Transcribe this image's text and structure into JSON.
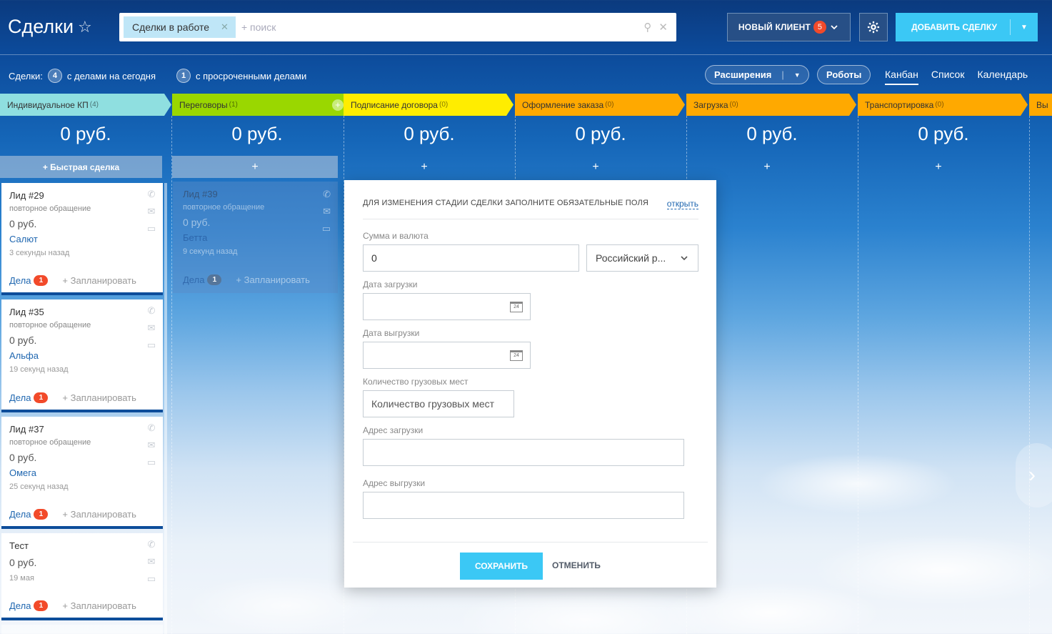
{
  "header": {
    "title": "Сделки",
    "filter_chip": "Сделки в работе",
    "search_placeholder": "+ поиск",
    "new_client_label": "НОВЫЙ КЛИЕНТ",
    "new_client_badge": "5",
    "add_deal_label": "ДОБАВИТЬ СДЕЛКУ"
  },
  "counters": {
    "prefix": "Сделки:",
    "today_count": "4",
    "today_label": "с делами на сегодня",
    "overdue_count": "1",
    "overdue_label": "с просроченными делами"
  },
  "toolbar": {
    "extensions": "Расширения",
    "robots": "Роботы",
    "views": [
      "Канбан",
      "Список",
      "Календарь"
    ]
  },
  "stages": [
    {
      "name": "Индивидуальное КП",
      "count": "(4)",
      "color": "#8fdfe0",
      "sum": "0 руб.",
      "add": "+ Быстрая сделка"
    },
    {
      "name": "Переговоры",
      "count": "(1)",
      "color": "#9ad700",
      "sum": "0 руб.",
      "add": "+"
    },
    {
      "name": "Подписание договора",
      "count": "(0)",
      "color": "#ffed00",
      "sum": "0 руб.",
      "add": "+"
    },
    {
      "name": "Оформление заказа",
      "count": "(0)",
      "color": "#ffa900",
      "sum": "0 руб.",
      "add": "+"
    },
    {
      "name": "Загрузка",
      "count": "(0)",
      "color": "#ffa900",
      "sum": "0 руб.",
      "add": "+"
    },
    {
      "name": "Транспортировка",
      "count": "(0)",
      "color": "#ffa900",
      "sum": "0 руб.",
      "add": "+"
    },
    {
      "name": "Вы",
      "count": "",
      "color": "#ffa900"
    }
  ],
  "cards": [
    {
      "name": "Лид #29",
      "sub": "повторное обращение",
      "amount": "0 руб.",
      "client": "Салют",
      "time": "3 секунды назад",
      "deals": "Дела",
      "deals_count": "1",
      "plan": "+ Запланировать"
    },
    {
      "name": "Лид #35",
      "sub": "повторное обращение",
      "amount": "0 руб.",
      "client": "Альфа",
      "time": "19 секунд назад",
      "deals": "Дела",
      "deals_count": "1",
      "plan": "+ Запланировать"
    },
    {
      "name": "Лид #37",
      "sub": "повторное обращение",
      "amount": "0 руб.",
      "client": "Омега",
      "time": "25 секунд назад",
      "deals": "Дела",
      "deals_count": "1",
      "plan": "+ Запланировать"
    },
    {
      "name": "Тест",
      "amount": "0 руб.",
      "time": "19 мая",
      "deals": "Дела",
      "deals_count": "1",
      "plan": "+ Запланировать"
    }
  ],
  "ghost_card": {
    "name": "Лид #39",
    "sub": "повторное обращение",
    "amount": "0 руб.",
    "client": "Бетта",
    "time": "9 секунд назад",
    "deals": "Дела",
    "deals_count": "1",
    "plan": "+ Запланировать"
  },
  "modal": {
    "header": "ДЛЯ ИЗМЕНЕНИЯ СТАДИИ СДЕЛКИ ЗАПОЛНИТЕ ОБЯЗАТЕЛЬНЫЕ ПОЛЯ",
    "open_link": "открыть",
    "amount_label": "Сумма и валюта",
    "amount_value": "0",
    "currency": "Российский р...",
    "load_date_label": "Дата загрузки",
    "unload_date_label": "Дата выгрузки",
    "cargo_label": "Количество грузовых мест",
    "cargo_placeholder": "Количество грузовых мест",
    "load_addr_label": "Адрес загрузки",
    "unload_addr_label": "Адрес выгрузки",
    "save": "СОХРАНИТЬ",
    "cancel": "ОТМЕНИТЬ"
  }
}
